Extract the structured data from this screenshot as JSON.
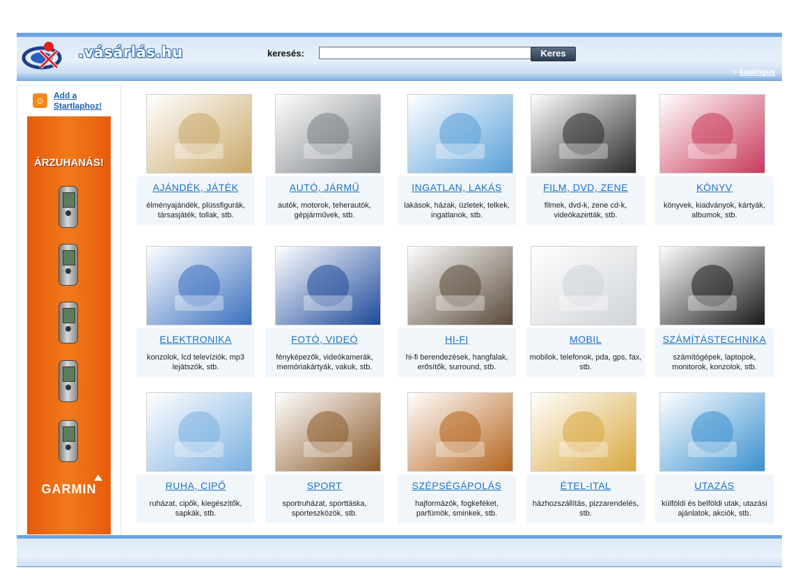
{
  "header": {
    "brand": ".vásárlás.hu",
    "search_label": "keresés:",
    "search_value": "",
    "search_button": "Keres",
    "catalog_arrow": ">",
    "catalog_link": "katalógus"
  },
  "sidebar": {
    "startlap_line1": "Add a",
    "startlap_line2": "Startlaphoz!",
    "ad_title": "ÁRZUHANÁS!",
    "ad_brand": "GARMIN"
  },
  "categories": [
    {
      "title": "AJÁNDÉK, JÁTÉK",
      "desc": "élményajándék, plüssfigurák, társasjáték, tollak, stb.",
      "icon": "gift-icon",
      "color": "#c9a86a"
    },
    {
      "title": "AUTÓ, JÁRMŰ",
      "desc": "autók, motorok, teherautók, gépjárművek, stb.",
      "icon": "car-icon",
      "color": "#7a7f84"
    },
    {
      "title": "INGATLAN, LAKÁS",
      "desc": "lakások, házak, üzletek, telkek, ingatlanok, stb.",
      "icon": "house-icon",
      "color": "#5aa0d8"
    },
    {
      "title": "FILM, DVD, ZENE",
      "desc": "filmek, dvd-k, zene cd-k, videókazetták, stb.",
      "icon": "disc-icon",
      "color": "#2a2a2a"
    },
    {
      "title": "KÖNYV",
      "desc": "könyvek, kiadványok, kártyák, albumok, stb.",
      "icon": "book-icon",
      "color": "#c83a5a"
    },
    {
      "title": "ELEKTRONIKA",
      "desc": "konzolok, lcd televíziók, mp3 lejátszók, stb.",
      "icon": "gamepad-icon",
      "color": "#3a6fbf"
    },
    {
      "title": "FOTÓ, VIDEÓ",
      "desc": "fényképezők, videókamerák, memóriakártyák, vakuk, stb.",
      "icon": "camera-icon",
      "color": "#1f4a9a"
    },
    {
      "title": "HI-FI",
      "desc": "hi-fi berendezések, hangfalak, erősítők, surround, stb.",
      "icon": "speaker-icon",
      "color": "#5a4a3a"
    },
    {
      "title": "MOBIL",
      "desc": "mobilok, telefonok, pda, gps, fax, stb.",
      "icon": "phone-icon",
      "color": "#d0d4d8"
    },
    {
      "title": "SZÁMÍTÁSTECHNIKA",
      "desc": "számítógépek, laptopok, monitorok, konzolok, stb.",
      "icon": "computer-icon",
      "color": "#1a1a1a"
    },
    {
      "title": "RUHA, CIPŐ",
      "desc": "ruházat, cipők, kiegészítők, sapkák, stb.",
      "icon": "shirt-icon",
      "color": "#7bb0e0"
    },
    {
      "title": "SPORT",
      "desc": "sportruházat, sporttáska, sporteszközök, stb.",
      "icon": "ball-icon",
      "color": "#8a5a2a"
    },
    {
      "title": "SZÉPSÉGÁPOLÁS",
      "desc": "hajformázók, fogkeféket, parfümök, sminkek, stb.",
      "icon": "perfume-icon",
      "color": "#b4641e"
    },
    {
      "title": "ÉTEL-ITAL",
      "desc": "házhozszállítás, pizzarendelés, stb.",
      "icon": "food-icon",
      "color": "#d8a840"
    },
    {
      "title": "UTAZÁS",
      "desc": "külföldi és belföldi utak, utazási ajánlatok, akciók, stb.",
      "icon": "beach-icon",
      "color": "#3a90d0"
    }
  ]
}
